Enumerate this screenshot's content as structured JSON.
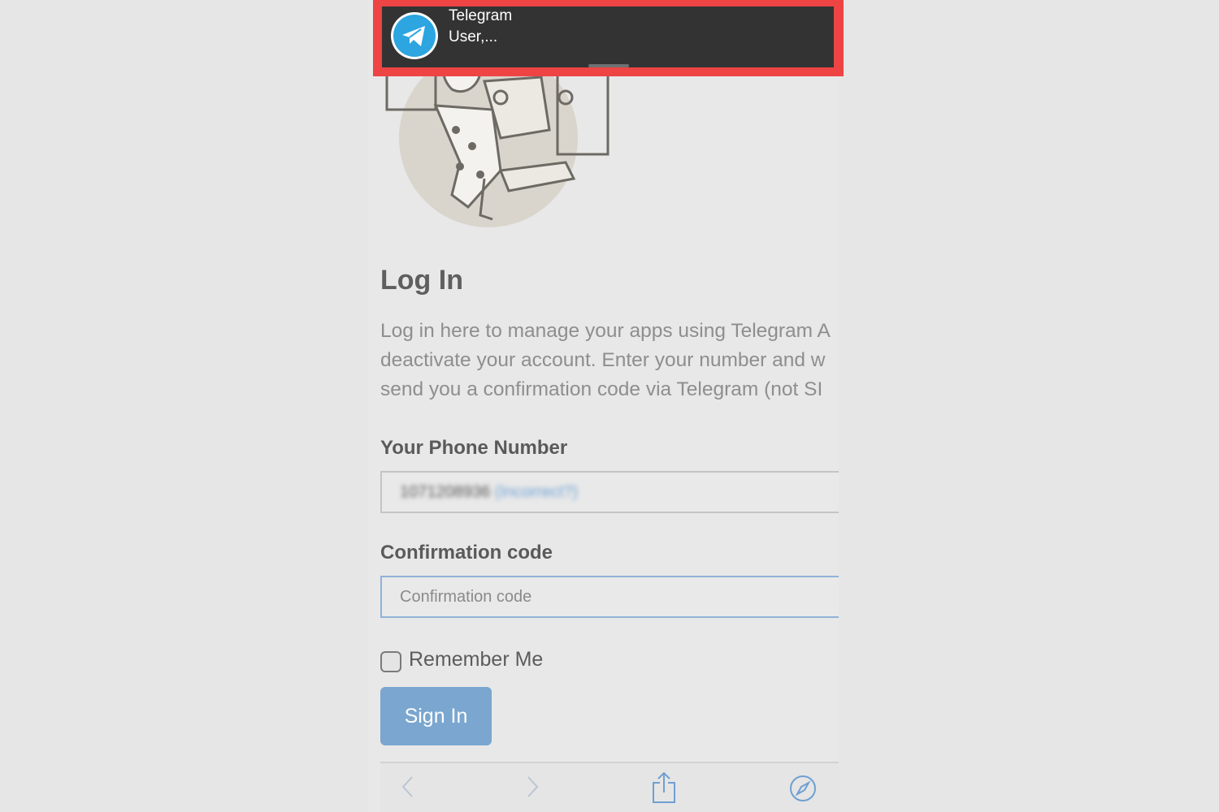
{
  "notification": {
    "app_name": "Telegram",
    "message": "User,...",
    "icon": "telegram-paper-plane-icon"
  },
  "login": {
    "title": "Log In",
    "description_lines": [
      "Log in here to manage your apps using Telegram A",
      "deactivate your account. Enter your number and w",
      "send you a confirmation code via Telegram (not SI"
    ],
    "phone_label": "Your Phone Number",
    "phone_value_blurred": "1071208936",
    "phone_tag_blurred": "(Incorrect?)",
    "code_label": "Confirmation code",
    "code_placeholder": "Confirmation code",
    "remember_label": "Remember Me",
    "remember_checked": false,
    "signin_label": "Sign In"
  },
  "toolbar": {
    "icons": [
      "back-icon",
      "forward-icon",
      "share-icon",
      "safari-compass-icon"
    ]
  },
  "colors": {
    "highlight": "#ee4444",
    "banner": "#333333",
    "button": "#7aa6cf",
    "accent": "#2ca5e0"
  }
}
